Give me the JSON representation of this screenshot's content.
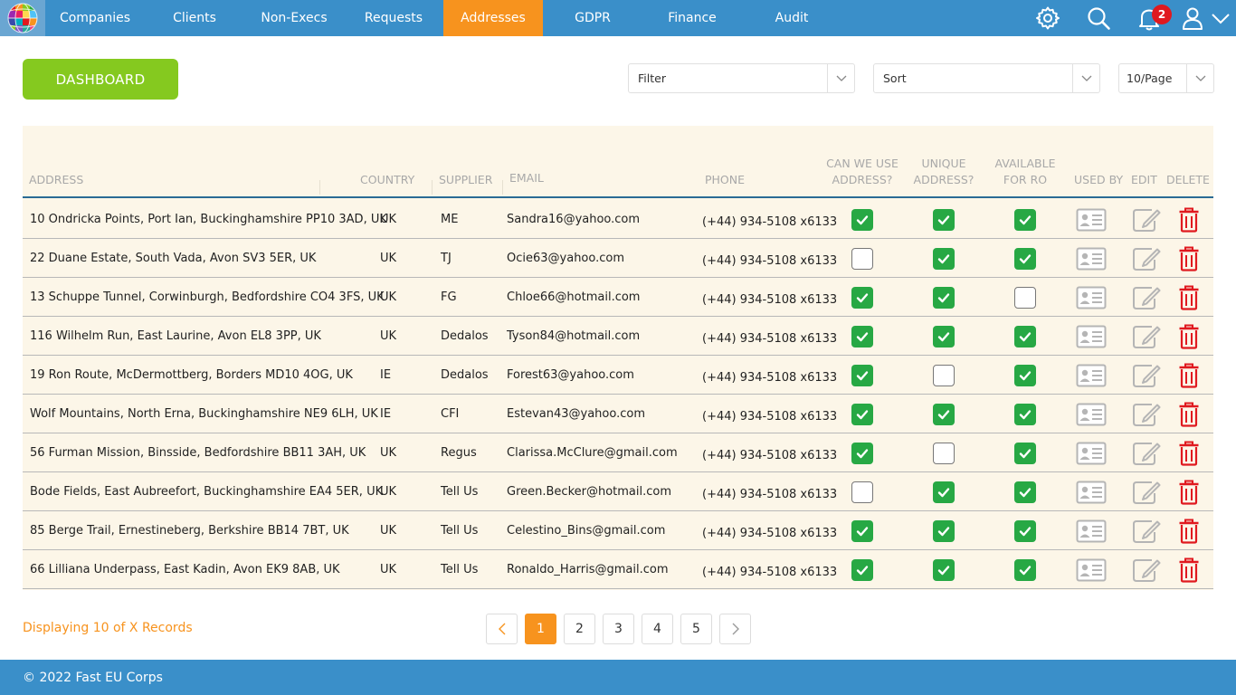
{
  "nav": {
    "items": [
      "Companies",
      "Clients",
      "Non-Execs",
      "Requests",
      "Addresses",
      "GDPR",
      "Finance",
      "Audit"
    ],
    "active_index": 4,
    "notification_count": "2"
  },
  "toolbar": {
    "dashboard_label": "DASHBOARD",
    "filter_value": "Filter",
    "sort_value": "Sort",
    "page_size_value": "10/Page"
  },
  "table": {
    "headers": {
      "address": "ADDRESS",
      "country": "COUNTRY",
      "supplier": "SUPPLIER",
      "email": "EMAIL",
      "phone": "PHONE",
      "can_use_1": "CAN WE USE",
      "can_use_2": "ADDRESS?",
      "unique_1": "UNIQUE",
      "unique_2": "ADDRESS?",
      "available_1": "AVAILABLE",
      "available_2": "FOR RO",
      "used_by": "USED BY",
      "edit": "EDIT",
      "delete": "DELETE"
    },
    "rows": [
      {
        "address": "10 Ondricka Points, Port Ian, Buckinghamshire PP10 3AD, UK",
        "country": "UK",
        "supplier": "ME",
        "email": "Sandra16@yahoo.com",
        "phone": "(+44) 934-5108 x6133",
        "can_use": true,
        "unique": true,
        "available": true
      },
      {
        "address": "22 Duane Estate, South Vada, Avon SV3 5ER, UK",
        "country": "UK",
        "supplier": "TJ",
        "email": "Ocie63@yahoo.com",
        "phone": "(+44) 934-5108 x6133",
        "can_use": false,
        "unique": true,
        "available": true
      },
      {
        "address": "13 Schuppe Tunnel, Corwinburgh, Bedfordshire CO4 3FS, UK",
        "country": "UK",
        "supplier": "FG",
        "email": "Chloe66@hotmail.com",
        "phone": "(+44) 934-5108 x6133",
        "can_use": true,
        "unique": true,
        "available": false
      },
      {
        "address": "116 Wilhelm Run, East Laurine, Avon EL8 3PP, UK",
        "country": "UK",
        "supplier": "Dedalos",
        "email": "Tyson84@hotmail.com",
        "phone": "(+44) 934-5108 x6133",
        "can_use": true,
        "unique": true,
        "available": true
      },
      {
        "address": "19 Ron Route, McDermottberg, Borders MD10 4OG, UK",
        "country": "IE",
        "supplier": "Dedalos",
        "email": "Forest63@yahoo.com",
        "phone": "(+44) 934-5108 x6133",
        "can_use": true,
        "unique": false,
        "available": true
      },
      {
        "address": "Wolf Mountains, North Erna, Buckinghamshire NE9 6LH, UK",
        "country": "IE",
        "supplier": "CFI",
        "email": "Estevan43@yahoo.com",
        "phone": "(+44) 934-5108 x6133",
        "can_use": true,
        "unique": true,
        "available": true
      },
      {
        "address": "56 Furman Mission, Binsside, Bedfordshire BB11 3AH, UK",
        "country": "UK",
        "supplier": "Regus",
        "email": "Clarissa.McClure@gmail.com",
        "phone": "(+44) 934-5108 x6133",
        "can_use": true,
        "unique": false,
        "available": true
      },
      {
        "address": "Bode Fields, East Aubreefort, Buckinghamshire EA4 5ER, UK",
        "country": "UK",
        "supplier": "Tell Us",
        "email": "Green.Becker@hotmail.com",
        "phone": "(+44) 934-5108 x6133",
        "can_use": false,
        "unique": true,
        "available": true
      },
      {
        "address": "85 Berge Trail, Ernestineberg, Berkshire BB14 7BT, UK",
        "country": "UK",
        "supplier": "Tell Us",
        "email": "Celestino_Bins@gmail.com",
        "phone": "(+44) 934-5108 x6133",
        "can_use": true,
        "unique": true,
        "available": true
      },
      {
        "address": "66 Lilliana Underpass, East Kadin, Avon EK9 8AB, UK",
        "country": "UK",
        "supplier": "Tell Us",
        "email": "Ronaldo_Harris@gmail.com",
        "phone": "(+44) 934-5108 x6133",
        "can_use": true,
        "unique": true,
        "available": true
      }
    ]
  },
  "pagination": {
    "displaying": "Displaying 10 of X Records",
    "pages": [
      "1",
      "2",
      "3",
      "4",
      "5"
    ],
    "current": "1"
  },
  "footer": {
    "text": "© 2022 Fast EU Corps"
  },
  "colors": {
    "nav_bg": "#3a8fc9",
    "active_tab": "#f7931e",
    "dashboard_button": "#85c91f",
    "check_on": "#27a844",
    "delete_icon": "#e0191f",
    "table_bg": "#fcf6e8"
  },
  "icons": {
    "settings": "gear-icon",
    "search": "search-icon",
    "notifications": "bell-icon",
    "user": "user-icon",
    "user_menu": "chevron-down-icon",
    "used_by": "contact-card-icon",
    "edit": "pencil-icon",
    "delete": "trash-icon"
  }
}
